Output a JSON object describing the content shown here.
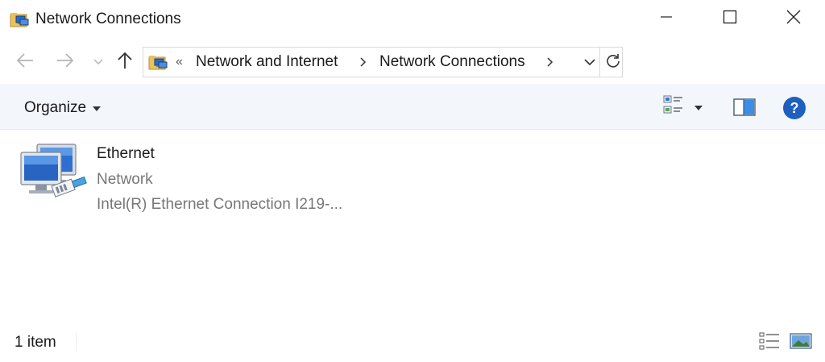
{
  "window": {
    "title": "Network Connections",
    "icons": {
      "app": "network-folder-icon",
      "minimize": "minimize-icon",
      "maximize": "maximize-icon",
      "close": "close-icon"
    }
  },
  "nav": {
    "icons": {
      "back": "arrow-left-icon",
      "forward": "arrow-right-icon",
      "recent": "chevron-down-icon",
      "up": "arrow-up-icon"
    }
  },
  "address": {
    "overflow": "«",
    "breadcrumbs": [
      "Network and Internet",
      "Network Connections"
    ],
    "icons": {
      "location": "network-folder-icon",
      "separator": "chevron-right-icon",
      "dropdown": "chevron-down-icon",
      "refresh": "refresh-icon"
    }
  },
  "toolbar": {
    "organize_label": "Organize",
    "icons": {
      "views": "change-view-icon",
      "preview_pane": "preview-pane-icon",
      "help": "help-icon"
    },
    "help_glyph": "?"
  },
  "items": [
    {
      "name": "Ethernet",
      "type": "Network",
      "device": "Intel(R) Ethernet Connection I219-...",
      "icon": "ethernet-adapter-icon"
    }
  ],
  "status": {
    "count": "1 item",
    "icons": {
      "details_view": "details-view-icon",
      "tiles_view": "large-icons-view-icon"
    }
  },
  "colors": {
    "accent": "#1f5fbf",
    "toolbar_bg": "#f3f6fa",
    "secondary_text": "#777777"
  }
}
